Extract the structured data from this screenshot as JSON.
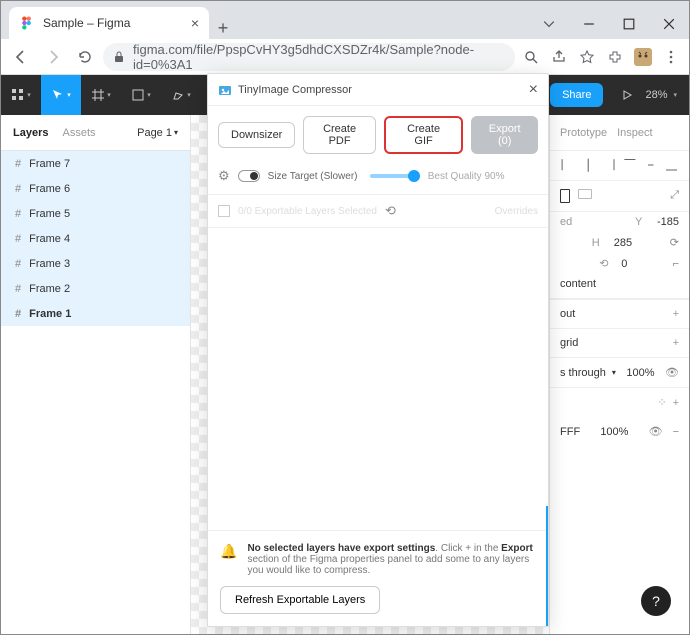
{
  "browser": {
    "tab_title": "Sample – Figma",
    "url_display": "figma.com/file/PpspCvHY3g5dhdCXSDZr4k/Sample?node-id=0%3A1",
    "url_domain": "figma.com"
  },
  "figma_toolbar": {
    "share_label": "Share",
    "zoom": "28%"
  },
  "left_panel": {
    "tabs": {
      "layers": "Layers",
      "assets": "Assets"
    },
    "page_indicator": "Page 1",
    "layers": [
      {
        "name": "Frame 7",
        "bold": false
      },
      {
        "name": "Frame 6",
        "bold": false
      },
      {
        "name": "Frame 5",
        "bold": false
      },
      {
        "name": "Frame 4",
        "bold": false
      },
      {
        "name": "Frame 3",
        "bold": false
      },
      {
        "name": "Frame 2",
        "bold": false
      },
      {
        "name": "Frame 1",
        "bold": true
      }
    ]
  },
  "right_panel": {
    "tabs": {
      "prototype": "Prototype",
      "inspect": "Inspect"
    },
    "y_value": "-185",
    "h_value": "285",
    "rot_value": "0",
    "clip_label": "content",
    "section_layout": "out",
    "section_grid": "grid",
    "pass_label": "s through",
    "pass_pct": "100%",
    "fill_hex": "FFF",
    "fill_pct": "100%"
  },
  "plugin": {
    "title": "TinyImage Compressor",
    "buttons": {
      "downsizer": "Downsizer",
      "create_pdf": "Create PDF",
      "create_gif": "Create GIF",
      "export": "Export (0)"
    },
    "slider_label": "Size Target (Slower)",
    "quality_label": "Best Quality 90%",
    "layers_selected": "0/0 Exportable Layers Selected",
    "overrides_label": "Overrides",
    "footer_msg_strong1": "No selected layers have export settings",
    "footer_msg_mid": ". Click + in the ",
    "footer_msg_strong2": "Export",
    "footer_msg_rest": " section of the Figma properties panel to add some to any layers you would like to compress.",
    "refresh_btn": "Refresh Exportable Layers"
  },
  "help": "?"
}
